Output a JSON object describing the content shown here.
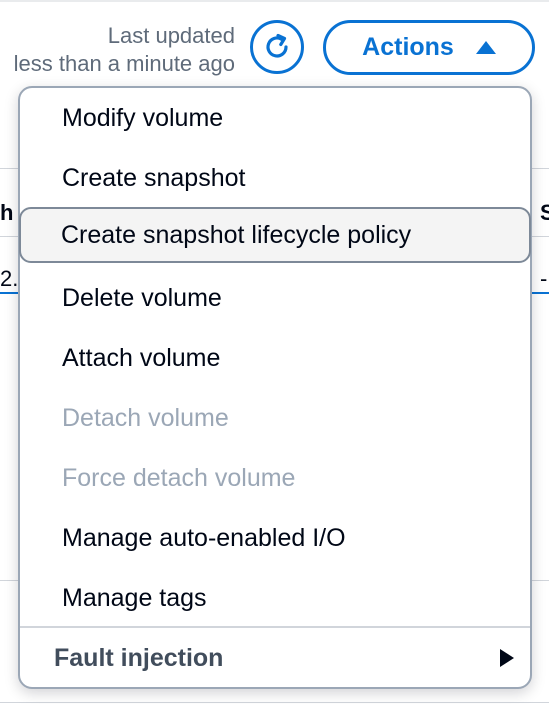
{
  "header": {
    "last_updated_line1": "Last updated",
    "last_updated_line2": "less than a minute ago",
    "refresh_label": "Refresh",
    "actions_label": "Actions"
  },
  "background_table": {
    "left_header_fragment": "h",
    "right_header_fragment": "S",
    "left_cell_fragment": "2.",
    "right_cell_fragment": "-"
  },
  "menu": {
    "items": [
      {
        "label": "Modify volume",
        "disabled": false
      },
      {
        "label": "Create snapshot",
        "disabled": false
      },
      {
        "label": "Create snapshot lifecycle policy",
        "disabled": false,
        "highlighted": true
      },
      {
        "label": "Delete volume",
        "disabled": false
      },
      {
        "label": "Attach volume",
        "disabled": false
      },
      {
        "label": "Detach volume",
        "disabled": true
      },
      {
        "label": "Force detach volume",
        "disabled": true
      },
      {
        "label": "Manage auto-enabled I/O",
        "disabled": false
      },
      {
        "label": "Manage tags",
        "disabled": false
      }
    ],
    "group": {
      "label": "Fault injection"
    }
  },
  "colors": {
    "accent": "#0972d3",
    "text": "#000716",
    "disabled_text": "#9ba7b6",
    "secondary_text": "#5f6b7a"
  },
  "icons": {
    "refresh": "refresh-icon",
    "actions_caret": "caret-up-icon",
    "submenu_caret": "caret-right-icon"
  }
}
